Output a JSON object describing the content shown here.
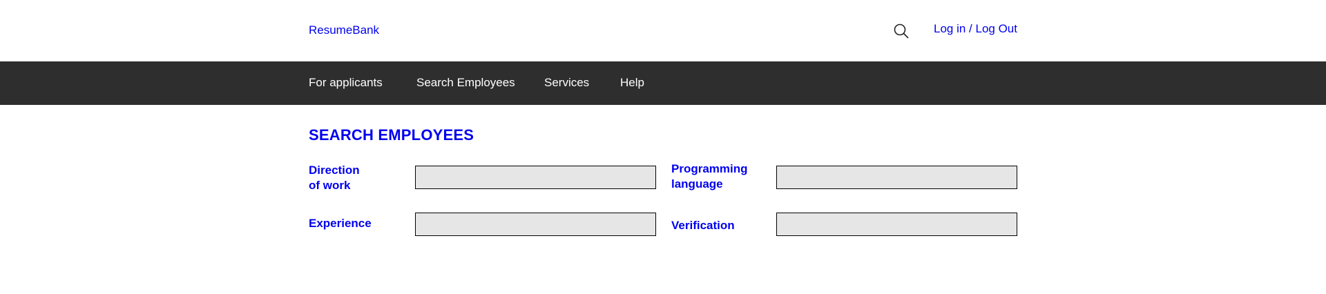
{
  "header": {
    "brand": "ResumeBank",
    "search_icon": "search-icon",
    "login_label": "Log in / Log Out"
  },
  "nav": {
    "items": [
      {
        "label": "For applicants"
      },
      {
        "label": "Search Employees"
      },
      {
        "label": "Services"
      },
      {
        "label": "Help"
      }
    ]
  },
  "main": {
    "title": "SEARCH EMPLOYEES",
    "fields": {
      "direction": {
        "label_line1": "Direction",
        "label_line2": "of work",
        "value": ""
      },
      "programming": {
        "label_line1": "Programming",
        "label_line2": "language",
        "value": ""
      },
      "experience": {
        "label": "Experience",
        "value": ""
      },
      "verification": {
        "label": "Verification",
        "value": ""
      }
    }
  },
  "colors": {
    "link": "#0000ee",
    "navbar_bg": "#2e2e2e",
    "input_bg": "#e6e6e6"
  }
}
